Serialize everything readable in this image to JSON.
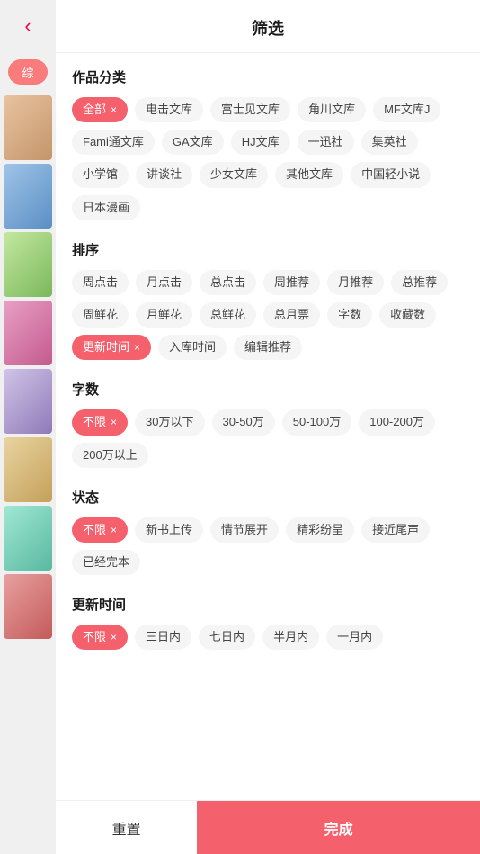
{
  "header": {
    "title": "筛选",
    "back_icon": "‹"
  },
  "sidebar": {
    "tag_label": "综",
    "images": [
      "p1",
      "p2",
      "p3",
      "p4",
      "p5",
      "p6",
      "p7",
      "p8"
    ]
  },
  "sections": [
    {
      "id": "category",
      "title": "作品分类",
      "tags": [
        {
          "label": "全部",
          "active": true,
          "closeable": true
        },
        {
          "label": "电击文库",
          "active": false,
          "closeable": false
        },
        {
          "label": "富士见文库",
          "active": false,
          "closeable": false
        },
        {
          "label": "角川文库",
          "active": false,
          "closeable": false
        },
        {
          "label": "MF文库J",
          "active": false,
          "closeable": false
        },
        {
          "label": "Fami通文库",
          "active": false,
          "closeable": false
        },
        {
          "label": "GA文库",
          "active": false,
          "closeable": false
        },
        {
          "label": "HJ文库",
          "active": false,
          "closeable": false
        },
        {
          "label": "一迅社",
          "active": false,
          "closeable": false
        },
        {
          "label": "集英社",
          "active": false,
          "closeable": false
        },
        {
          "label": "小学馆",
          "active": false,
          "closeable": false
        },
        {
          "label": "讲谈社",
          "active": false,
          "closeable": false
        },
        {
          "label": "少女文库",
          "active": false,
          "closeable": false
        },
        {
          "label": "其他文库",
          "active": false,
          "closeable": false
        },
        {
          "label": "中国轻小说",
          "active": false,
          "closeable": false
        },
        {
          "label": "日本漫画",
          "active": false,
          "closeable": false
        }
      ]
    },
    {
      "id": "sort",
      "title": "排序",
      "tags": [
        {
          "label": "周点击",
          "active": false,
          "closeable": false
        },
        {
          "label": "月点击",
          "active": false,
          "closeable": false
        },
        {
          "label": "总点击",
          "active": false,
          "closeable": false
        },
        {
          "label": "周推荐",
          "active": false,
          "closeable": false
        },
        {
          "label": "月推荐",
          "active": false,
          "closeable": false
        },
        {
          "label": "总推荐",
          "active": false,
          "closeable": false
        },
        {
          "label": "周鲜花",
          "active": false,
          "closeable": false
        },
        {
          "label": "月鲜花",
          "active": false,
          "closeable": false
        },
        {
          "label": "总鲜花",
          "active": false,
          "closeable": false
        },
        {
          "label": "总月票",
          "active": false,
          "closeable": false
        },
        {
          "label": "字数",
          "active": false,
          "closeable": false
        },
        {
          "label": "收藏数",
          "active": false,
          "closeable": false
        },
        {
          "label": "更新时间",
          "active": true,
          "closeable": true
        },
        {
          "label": "入库时间",
          "active": false,
          "closeable": false
        },
        {
          "label": "编辑推荐",
          "active": false,
          "closeable": false
        }
      ]
    },
    {
      "id": "wordcount",
      "title": "字数",
      "tags": [
        {
          "label": "不限",
          "active": true,
          "closeable": true
        },
        {
          "label": "30万以下",
          "active": false,
          "closeable": false
        },
        {
          "label": "30-50万",
          "active": false,
          "closeable": false
        },
        {
          "label": "50-100万",
          "active": false,
          "closeable": false
        },
        {
          "label": "100-200万",
          "active": false,
          "closeable": false
        },
        {
          "label": "200万以上",
          "active": false,
          "closeable": false
        }
      ]
    },
    {
      "id": "status",
      "title": "状态",
      "tags": [
        {
          "label": "不限",
          "active": true,
          "closeable": true
        },
        {
          "label": "新书上传",
          "active": false,
          "closeable": false
        },
        {
          "label": "情节展开",
          "active": false,
          "closeable": false
        },
        {
          "label": "精彩纷呈",
          "active": false,
          "closeable": false
        },
        {
          "label": "接近尾声",
          "active": false,
          "closeable": false
        },
        {
          "label": "已经完本",
          "active": false,
          "closeable": false
        }
      ]
    },
    {
      "id": "update_time",
      "title": "更新时间",
      "tags": [
        {
          "label": "不限",
          "active": true,
          "closeable": true
        },
        {
          "label": "三日内",
          "active": false,
          "closeable": false
        },
        {
          "label": "七日内",
          "active": false,
          "closeable": false
        },
        {
          "label": "半月内",
          "active": false,
          "closeable": false
        },
        {
          "label": "一月内",
          "active": false,
          "closeable": false
        }
      ]
    }
  ],
  "footer": {
    "reset_label": "重置",
    "confirm_label": "完成"
  }
}
